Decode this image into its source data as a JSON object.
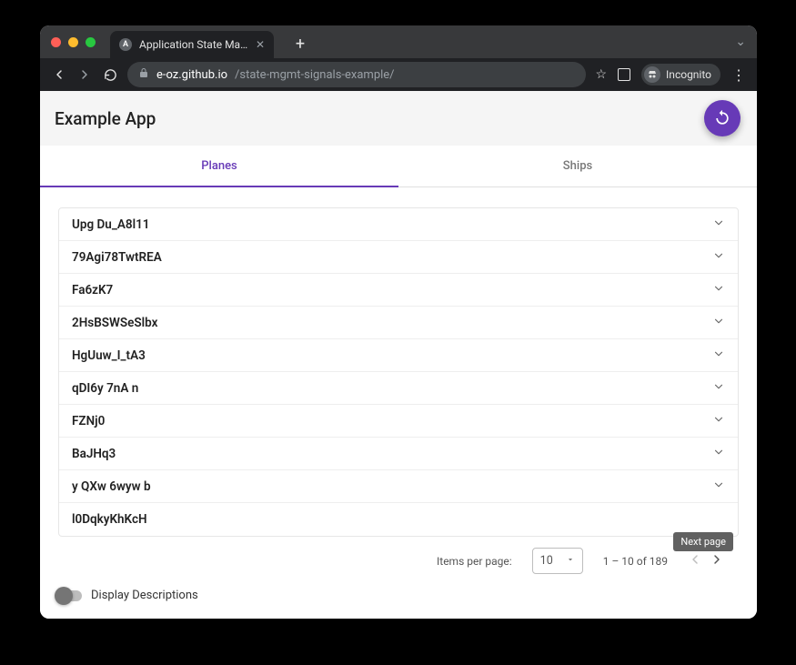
{
  "browser": {
    "tab_title": "Application State Management",
    "tab_favicon_letter": "A",
    "new_tab_glyph": "+",
    "caret_glyph": "⌄",
    "url_host": "e-oz.github.io",
    "url_path": "/state-mgmt-signals-example/",
    "star_glyph": "☆",
    "incognito_label": "Incognito",
    "kebab_glyph": "⋮",
    "close_glyph": "✕"
  },
  "app": {
    "title": "Example App",
    "tabs": [
      "Planes",
      "Ships"
    ],
    "active_tab": 0
  },
  "list": {
    "items": [
      "Upg Du_A8l11",
      "79Agi78TwtREA",
      "Fa6zK7",
      "2HsBSWSeSlbx",
      "HgUuw_I_tA3",
      "qDI6y 7nA n",
      "FZNj0",
      "BaJHq3",
      "y QXw 6wyw b",
      "l0DqkyKhKcH"
    ]
  },
  "tooltip": {
    "next_page": "Next page"
  },
  "paginator": {
    "label": "Items per page:",
    "page_size": "10",
    "range": "1 – 10 of 189"
  },
  "footer": {
    "toggle_label": "Display Descriptions"
  },
  "colors": {
    "accent": "#673ab7"
  }
}
